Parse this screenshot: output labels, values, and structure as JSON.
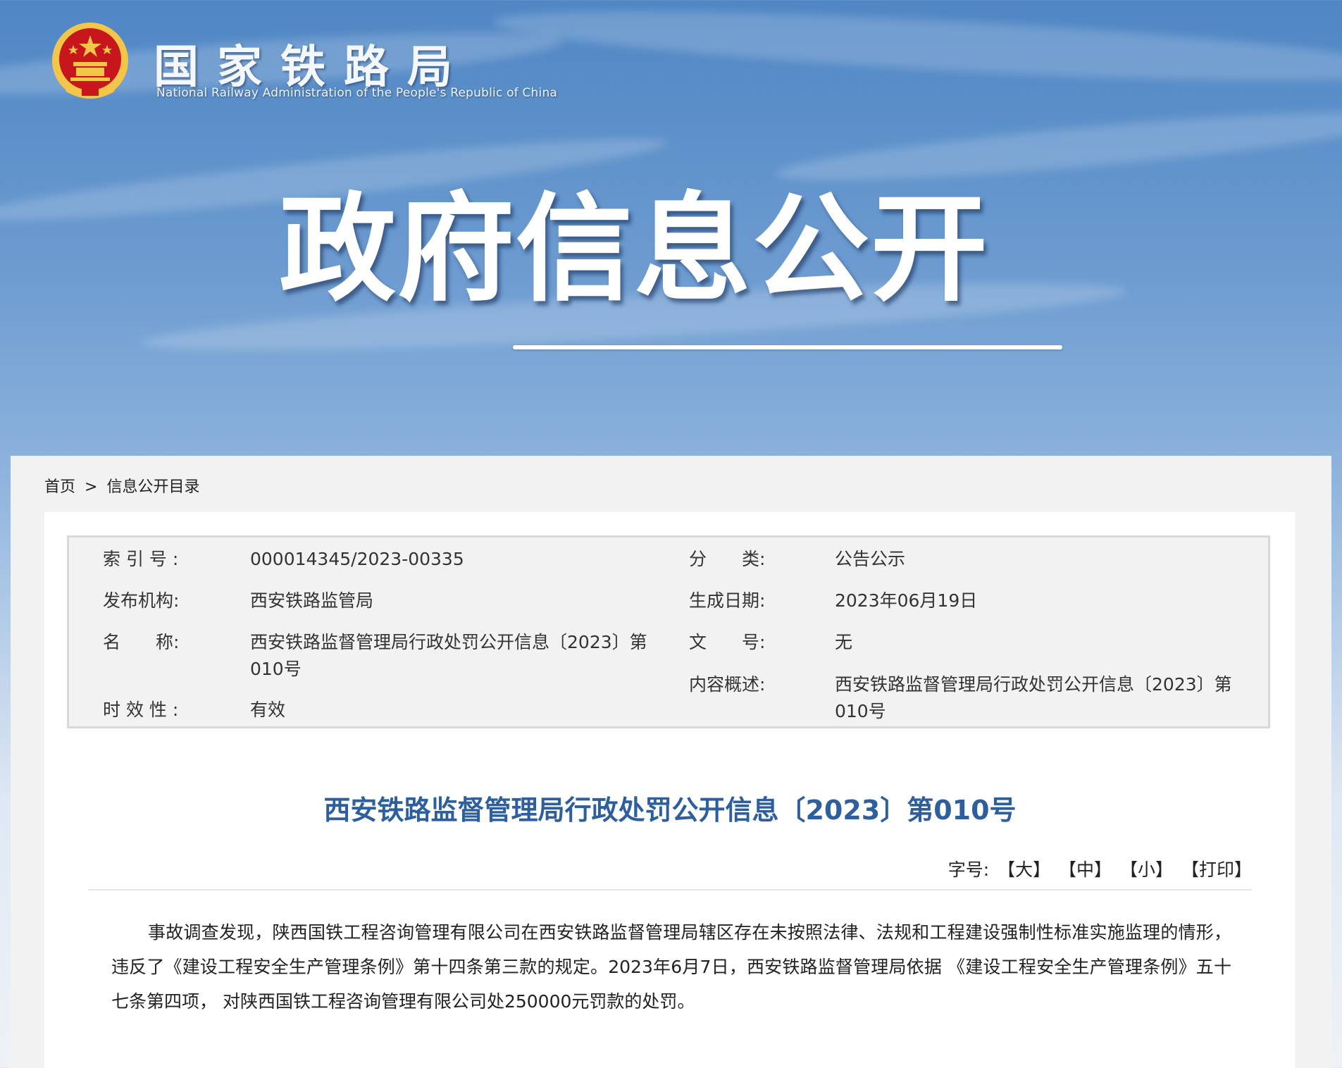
{
  "header": {
    "site_title": "国家铁路局",
    "site_subtitle": "National Railway Administration of the People's Republic of China",
    "banner_title": "政府信息公开"
  },
  "breadcrumb": {
    "home": "首页",
    "separator": ">",
    "current": "信息公开目录"
  },
  "meta": {
    "index_label": "索 引 号 :",
    "index_value": "000014345/2023-00335",
    "category_label": "分　　类:",
    "category_value": "公告公示",
    "publisher_label": "发布机构:",
    "publisher_value": "西安铁路监管局",
    "date_label": "生成日期:",
    "date_value": "2023年06月19日",
    "name_label": "名　　称:",
    "name_value": "西安铁路监督管理局行政处罚公开信息〔2023〕第010号",
    "docno_label": "文　　号:",
    "docno_value": "无",
    "summary_label": "内容概述:",
    "summary_value": "西安铁路监督管理局行政处罚公开信息〔2023〕第010号",
    "validity_label": "时 效 性 :",
    "validity_value": "有效"
  },
  "document": {
    "title": "西安铁路监督管理局行政处罚公开信息〔2023〕第010号",
    "font_size_label": "字号:",
    "font_large": "【大】",
    "font_medium": "【中】",
    "font_small": "【小】",
    "print": "【打印】",
    "body": "事故调查发现，陕西国铁工程咨询管理有限公司在西安铁路监督管理局辖区存在未按照法律、法规和工程建设强制性标准实施监理的情形，违反了《建设工程安全生产管理条例》第十四条第三款的规定。2023年6月7日，西安铁路监督管理局依据 《建设工程安全生产管理条例》五十七条第四项， 对陕西国铁工程咨询管理有限公司处250000元罚款的处罚。"
  },
  "colors": {
    "title_blue": "#2d5f9e",
    "emblem_red": "#c8161d",
    "emblem_gold": "#f3c64a"
  }
}
